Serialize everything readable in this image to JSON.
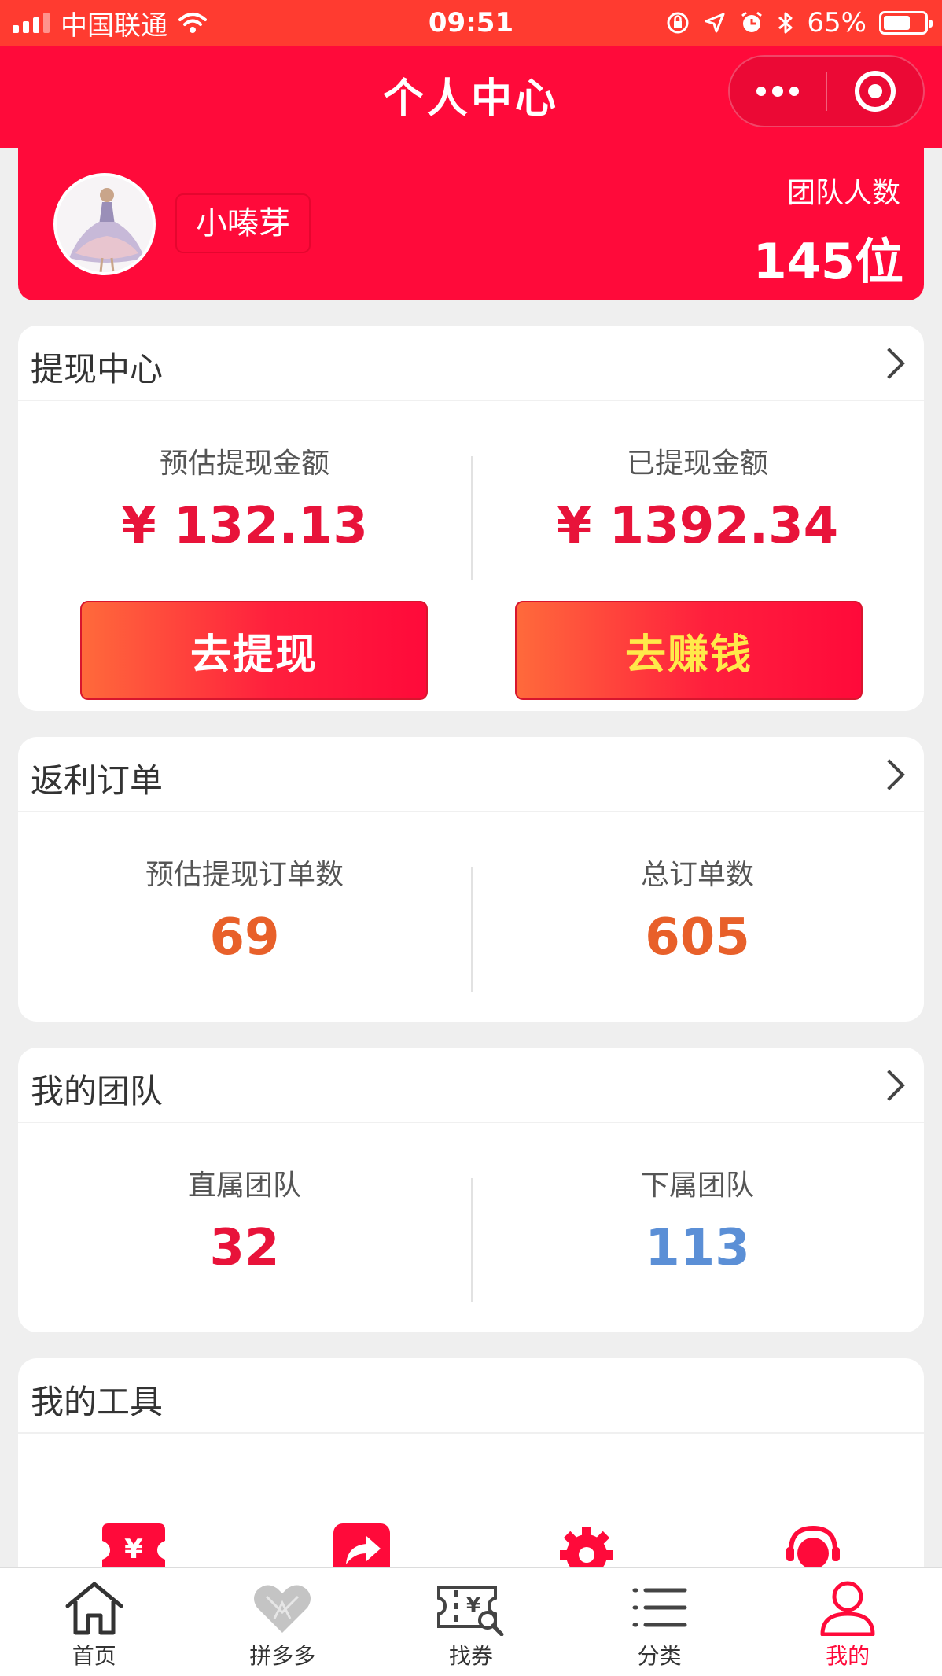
{
  "status_bar": {
    "carrier": "中国联通",
    "time": "09:51",
    "battery": "65%",
    "battery_level": 0.65
  },
  "nav": {
    "title": "个人中心"
  },
  "profile": {
    "nickname": "小嗪芽",
    "team_label": "团队人数",
    "team_count": "145位"
  },
  "withdraw": {
    "title": "提现中心",
    "left_label": "预估提现金额",
    "left_value": "¥  132.13",
    "right_label": "已提现金额",
    "right_value": "¥  1392.34",
    "left_button": "去提现",
    "right_button": "去赚钱"
  },
  "orders": {
    "title": "返利订单",
    "left_label": "预估提现订单数",
    "left_value": "69",
    "right_label": "总订单数",
    "right_value": "605"
  },
  "team": {
    "title": "我的团队",
    "left_label": "直属团队",
    "left_value": "32",
    "right_label": "下属团队",
    "right_value": "113"
  },
  "tools": {
    "title": "我的工具",
    "icons": [
      "coupon-icon",
      "share-icon",
      "settings-icon",
      "customer-service-icon"
    ]
  },
  "tabbar": {
    "items": [
      {
        "label": "首页",
        "icon": "home-icon"
      },
      {
        "label": "拼多多",
        "icon": "pinduoduo-icon"
      },
      {
        "label": "找券",
        "icon": "coupon-search-icon"
      },
      {
        "label": "分类",
        "icon": "category-list-icon"
      },
      {
        "label": "我的",
        "icon": "user-icon"
      }
    ],
    "active_index": 4
  },
  "colors": {
    "brand_red": "#ff0a3a",
    "status_red": "#ff3b30",
    "value_red": "#e8133a",
    "value_orange": "#e8602a",
    "value_blue": "#5b8fd6",
    "button_yellow_text": "#ffe94a"
  }
}
